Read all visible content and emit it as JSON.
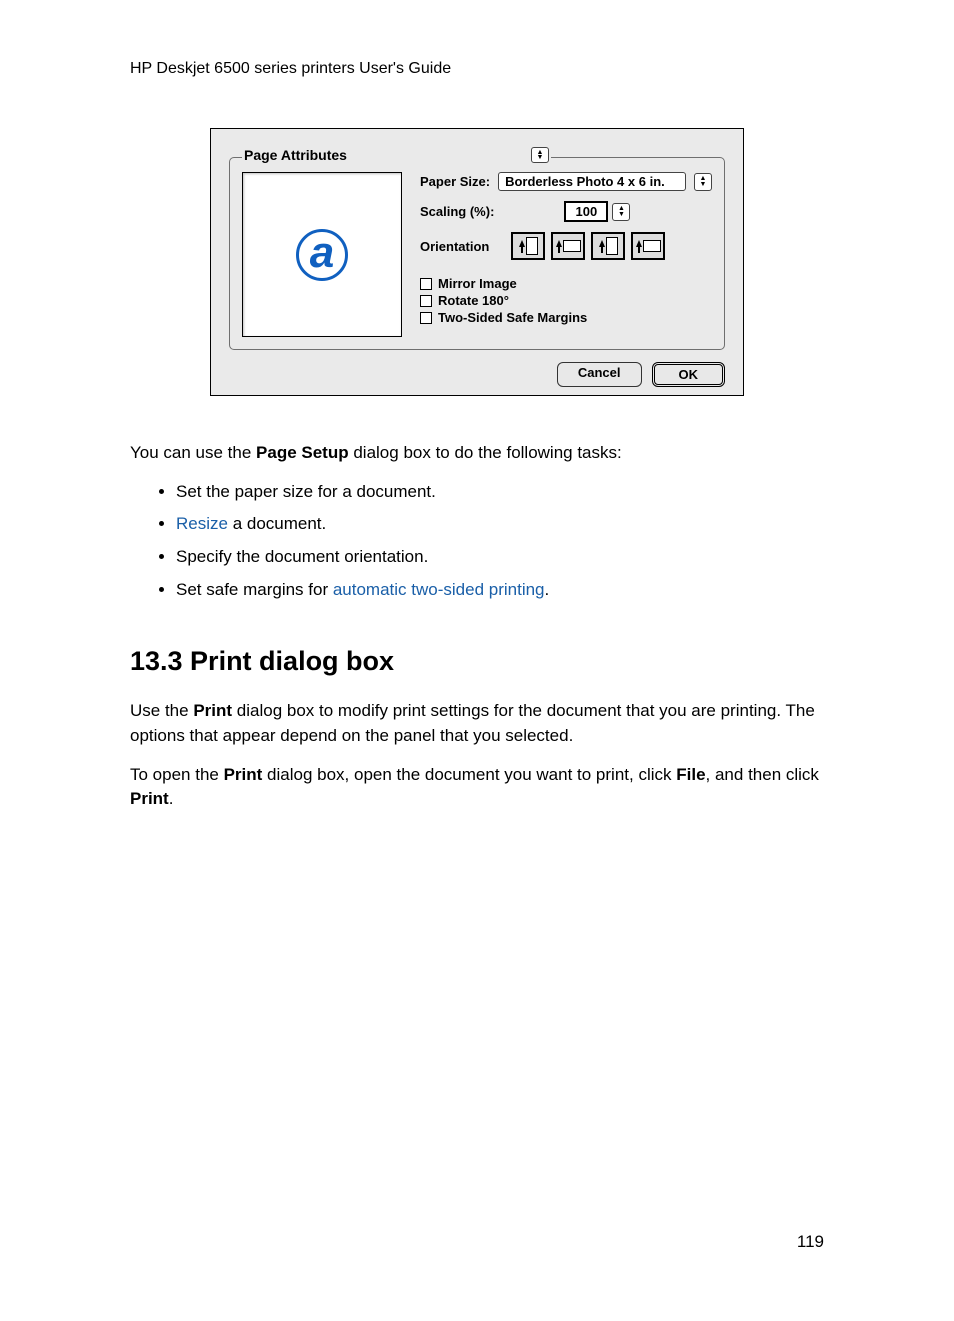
{
  "header": "HP Deskjet 6500 series printers User's Guide",
  "dialog": {
    "tab": "Page Attributes",
    "paperSizeLabel": "Paper Size:",
    "paperSizeValue": "Borderless Photo 4 x 6 in.",
    "scalingLabel": "Scaling (%):",
    "scalingValue": "100",
    "orientationLabel": "Orientation",
    "checkboxes": {
      "mirror": "Mirror Image",
      "rotate": "Rotate 180°",
      "margins": "Two-Sided Safe Margins"
    },
    "cancel": "Cancel",
    "ok": "OK"
  },
  "intro": {
    "pre": "You can use the ",
    "bold": "Page Setup",
    "post": " dialog box to do the following tasks:"
  },
  "list": {
    "item1": "Set the paper size for a document.",
    "item2_link": "Resize",
    "item2_post": " a document.",
    "item3": "Specify the document orientation.",
    "item4_pre": "Set safe margins for ",
    "item4_link": "automatic two-sided printing",
    "item4_post": "."
  },
  "section": {
    "heading": "13.3  Print dialog box",
    "p1_pre": "Use the ",
    "p1_b1": "Print",
    "p1_post": " dialog box to modify print settings for the document that you are printing. The options that appear depend on the panel that you selected.",
    "p2_pre": "To open the ",
    "p2_b1": "Print",
    "p2_mid": " dialog box, open the document you want to print, click ",
    "p2_b2": "File",
    "p2_mid2": ", and then click ",
    "p2_b3": "Print",
    "p2_post": "."
  },
  "pageNumber": "119"
}
